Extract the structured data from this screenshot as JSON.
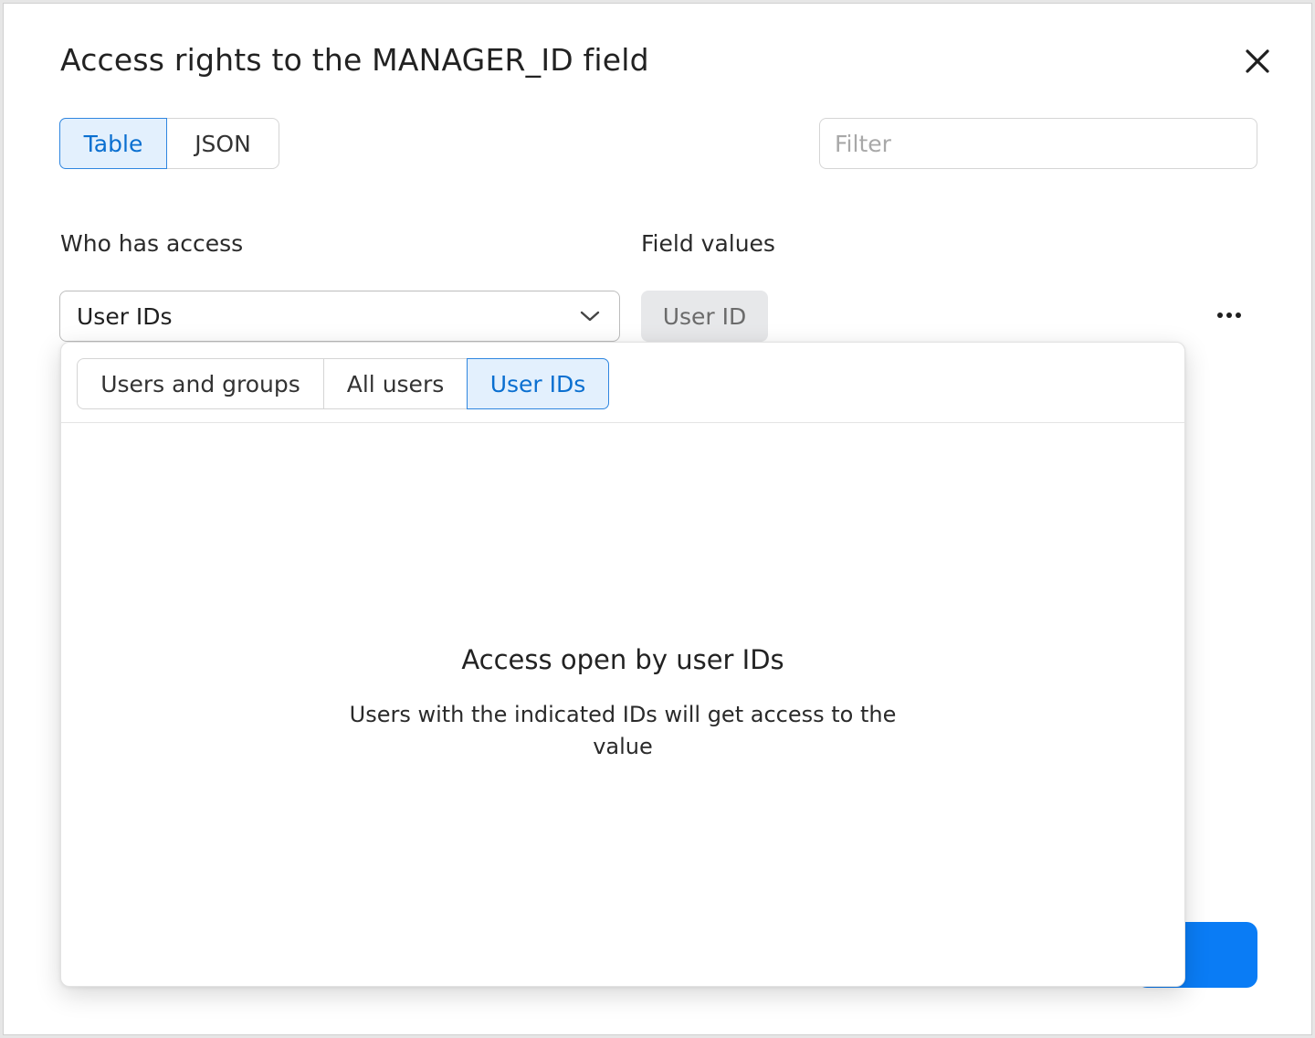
{
  "dialog": {
    "title": "Access rights to the MANAGER_ID field"
  },
  "view_toggle": {
    "options": [
      "Table",
      "JSON"
    ],
    "selected": "Table"
  },
  "filter": {
    "placeholder": "Filter",
    "value": ""
  },
  "columns": {
    "who_has_access": "Who has access",
    "field_values": "Field values"
  },
  "access_select": {
    "selected": "User IDs"
  },
  "field_value_chip": {
    "label": "User ID"
  },
  "popup": {
    "tabs": [
      "Users and groups",
      "All users",
      "User IDs"
    ],
    "active_tab": "User IDs",
    "empty_title": "Access open by user IDs",
    "empty_description": "Users with the indicated IDs will get access to the value"
  },
  "colors": {
    "accent": "#0a7cf5",
    "selected_bg": "#e3f0fd",
    "selected_text": "#0a6fd0"
  },
  "icons": {
    "close": "close-icon",
    "dropdown": "chevron-down-icon",
    "more": "more-horizontal-icon"
  }
}
